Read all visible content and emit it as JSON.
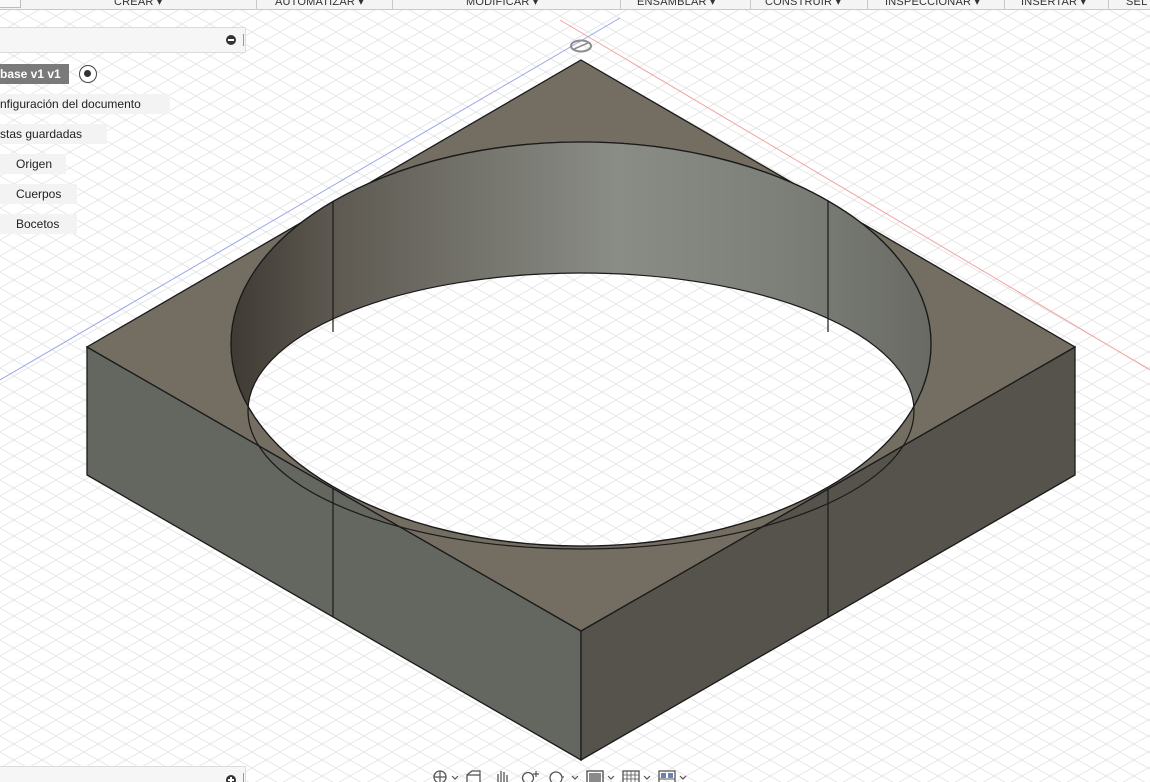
{
  "toolbar": {
    "menus": [
      {
        "label": "CREAR ▾"
      },
      {
        "label": "AUTOMATIZAR ▾"
      },
      {
        "label": "MODIFICAR ▾"
      },
      {
        "label": "ENSAMBLAR ▾"
      },
      {
        "label": "CONSTRUIR ▾"
      },
      {
        "label": "INSPECCIONAR ▾"
      },
      {
        "label": "INSERTAR ▾"
      },
      {
        "label": "SEL"
      }
    ]
  },
  "browser": {
    "collapse_icon": "minus-circle-icon",
    "root": {
      "label": "base v1 v1"
    },
    "items": [
      {
        "label": "nfiguración del documento"
      },
      {
        "label": "stas guardadas"
      },
      {
        "label": "Origen"
      },
      {
        "label": "Cuerpos"
      },
      {
        "label": "Bocetos"
      }
    ]
  },
  "comments": {
    "expand_icon": "plus-circle-icon"
  },
  "navbar": {
    "tools": [
      {
        "icon": "orbit-icon"
      },
      {
        "icon": "look-at-icon"
      },
      {
        "icon": "pan-hand-icon"
      },
      {
        "icon": "zoom-icon"
      },
      {
        "icon": "fit-icon"
      },
      {
        "icon": "display-settings-icon"
      },
      {
        "icon": "grid-settings-icon"
      },
      {
        "icon": "viewports-icon"
      }
    ]
  },
  "colors": {
    "background": "#ffffff",
    "grid": "#d4d4d4",
    "axis_red": "#f2a3a3",
    "axis_blue": "#9aa6e8",
    "top_face": "#746d61",
    "front_left_face": "#646760",
    "front_right_face": "#56534c",
    "edge": "#1a1a1a"
  }
}
